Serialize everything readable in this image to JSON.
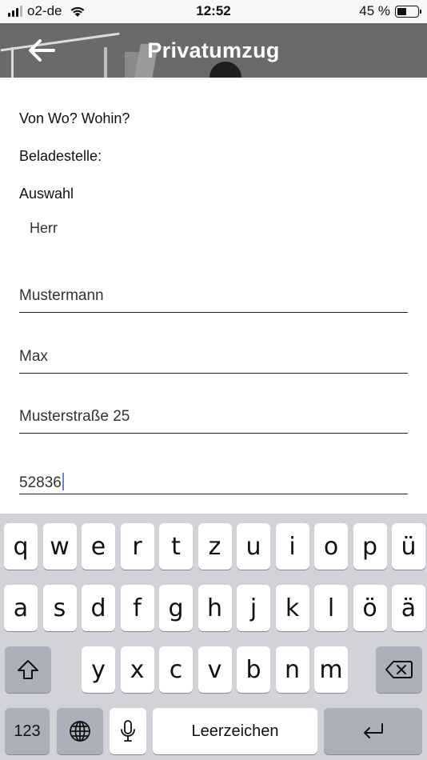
{
  "status_bar": {
    "carrier": "o2-de",
    "time": "12:52",
    "battery_percent": "45 %",
    "battery_level": 0.45
  },
  "app_bar": {
    "title": "Privatumzug",
    "back_icon": "arrow-left-icon"
  },
  "form": {
    "section_title": "Von Wo? Wohin?",
    "loading_label": "Beladestelle:",
    "salutation_label": "Auswahl",
    "salutation_value": "Herr",
    "fields": {
      "last_name": "Mustermann",
      "first_name": "Max",
      "street": "Musterstraße 25",
      "postal_code": "52836"
    }
  },
  "keyboard": {
    "row1": [
      "q",
      "w",
      "e",
      "r",
      "t",
      "z",
      "u",
      "i",
      "o",
      "p",
      "ü"
    ],
    "row2": [
      "a",
      "s",
      "d",
      "f",
      "g",
      "h",
      "j",
      "k",
      "l",
      "ö",
      "ä"
    ],
    "row3": [
      "y",
      "x",
      "c",
      "v",
      "b",
      "n",
      "m"
    ],
    "numbers_label": "123",
    "space_label": "Leerzeichen",
    "icons": {
      "shift": "shift-icon",
      "delete": "backspace-icon",
      "globe": "globe-icon",
      "mic": "microphone-icon",
      "return": "return-icon"
    },
    "colors": {
      "background": "#d1d3d9",
      "key": "#ffffff",
      "function_key": "#acb0bb"
    }
  }
}
